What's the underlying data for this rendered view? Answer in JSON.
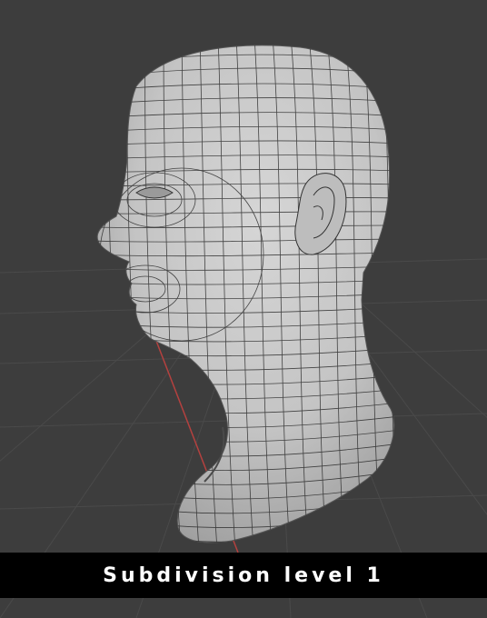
{
  "caption": {
    "text": "Subdivision level 1"
  },
  "scene": {
    "subject": "head-mesh",
    "background_color": "#3d3d3d",
    "grid_line_color": "#4a4a4a",
    "axis_color": "#b4413f",
    "mesh_fill": "#c9c9c9",
    "mesh_wire": "#2b2b2b"
  },
  "colors": {
    "caption_bar": "#000000",
    "caption_text": "#ffffff"
  }
}
